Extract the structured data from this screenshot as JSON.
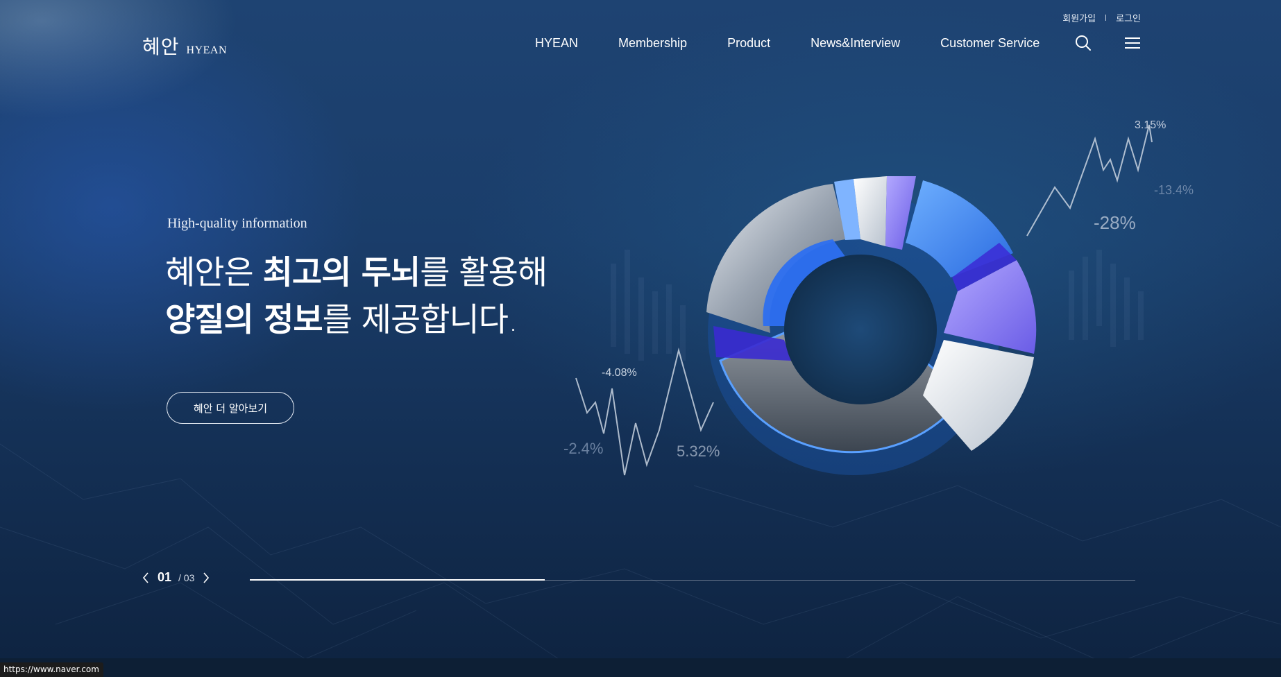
{
  "util_links": [
    "회원가입",
    "로그인"
  ],
  "logo": {
    "ko": "혜안",
    "en": "HYEAN"
  },
  "nav": [
    "HYEAN",
    "Membership",
    "Product",
    "News&Interview",
    "Customer Service"
  ],
  "icons": {
    "search": "search-icon",
    "menu": "hamburger-menu-icon"
  },
  "hero": {
    "eyebrow": "High-quality information",
    "line1_a": "혜안은 ",
    "line1_b": "최고의 두뇌",
    "line1_c": "를 활용해",
    "line2_a": "양질의 정보",
    "line2_b": "를 제공합니다.",
    "cta": "혜안 더 알아보기"
  },
  "visual_labels": [
    "3.15%",
    "-13.4%",
    "-28%",
    "-4.08%",
    "-2.4%",
    "5.32%"
  ],
  "pager": {
    "current": "01",
    "total": "/ 03",
    "progress": 0.333
  },
  "status_url": "https://www.naver.com",
  "colors": {
    "accent": "#3f7fe0",
    "violet": "#8f83ef",
    "bg": "#132e52"
  }
}
